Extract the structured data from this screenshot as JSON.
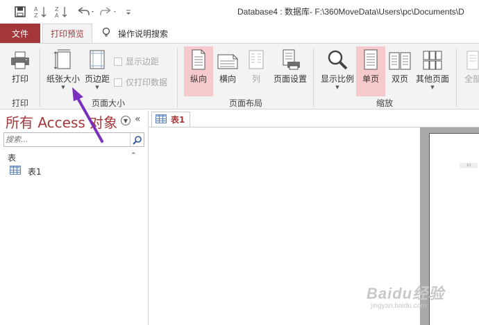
{
  "window": {
    "title": "Database4 : 数据库- F:\\360MoveData\\Users\\pc\\Documents\\D"
  },
  "quick_access": {
    "icons": [
      "save-icon",
      "sort-ascending-icon",
      "sort-descending-icon",
      "undo-icon",
      "redo-icon",
      "customize-icon"
    ]
  },
  "tabs": {
    "file": "文件",
    "print_preview": "打印预览",
    "tell_me": "操作说明搜索"
  },
  "ribbon": {
    "print_group": {
      "print_label": "打印",
      "label": "打印"
    },
    "page_size_group": {
      "paper_size_label": "纸张大小",
      "margins_label": "页边距",
      "show_margins_label": "显示边距",
      "print_data_only_label": "仅打印数据",
      "label": "页面大小"
    },
    "page_layout_group": {
      "portrait_label": "纵向",
      "landscape_label": "横向",
      "columns_label": "列",
      "page_setup_label": "页面设置",
      "label": "页面布局"
    },
    "zoom_group": {
      "zoom_label": "显示比例",
      "one_page_label": "单页",
      "two_pages_label": "双页",
      "more_pages_label": "其他页面",
      "label": "缩放"
    },
    "overflow_label": "全部"
  },
  "nav_pane": {
    "title": "所有 Access 对象",
    "search_placeholder": "搜索...",
    "group_label": "表",
    "items": [
      {
        "label": "表1"
      }
    ]
  },
  "document": {
    "tab_label": "表1",
    "page_mark": "10"
  },
  "watermark": {
    "main": "Baidu经验",
    "sub": "jingyan.baidu.com"
  },
  "colors": {
    "accent": "#a4373a",
    "selected_button": "#f6c9cc",
    "ribbon_bg": "#f3f3f3",
    "annotation": "#7b2fbe"
  }
}
